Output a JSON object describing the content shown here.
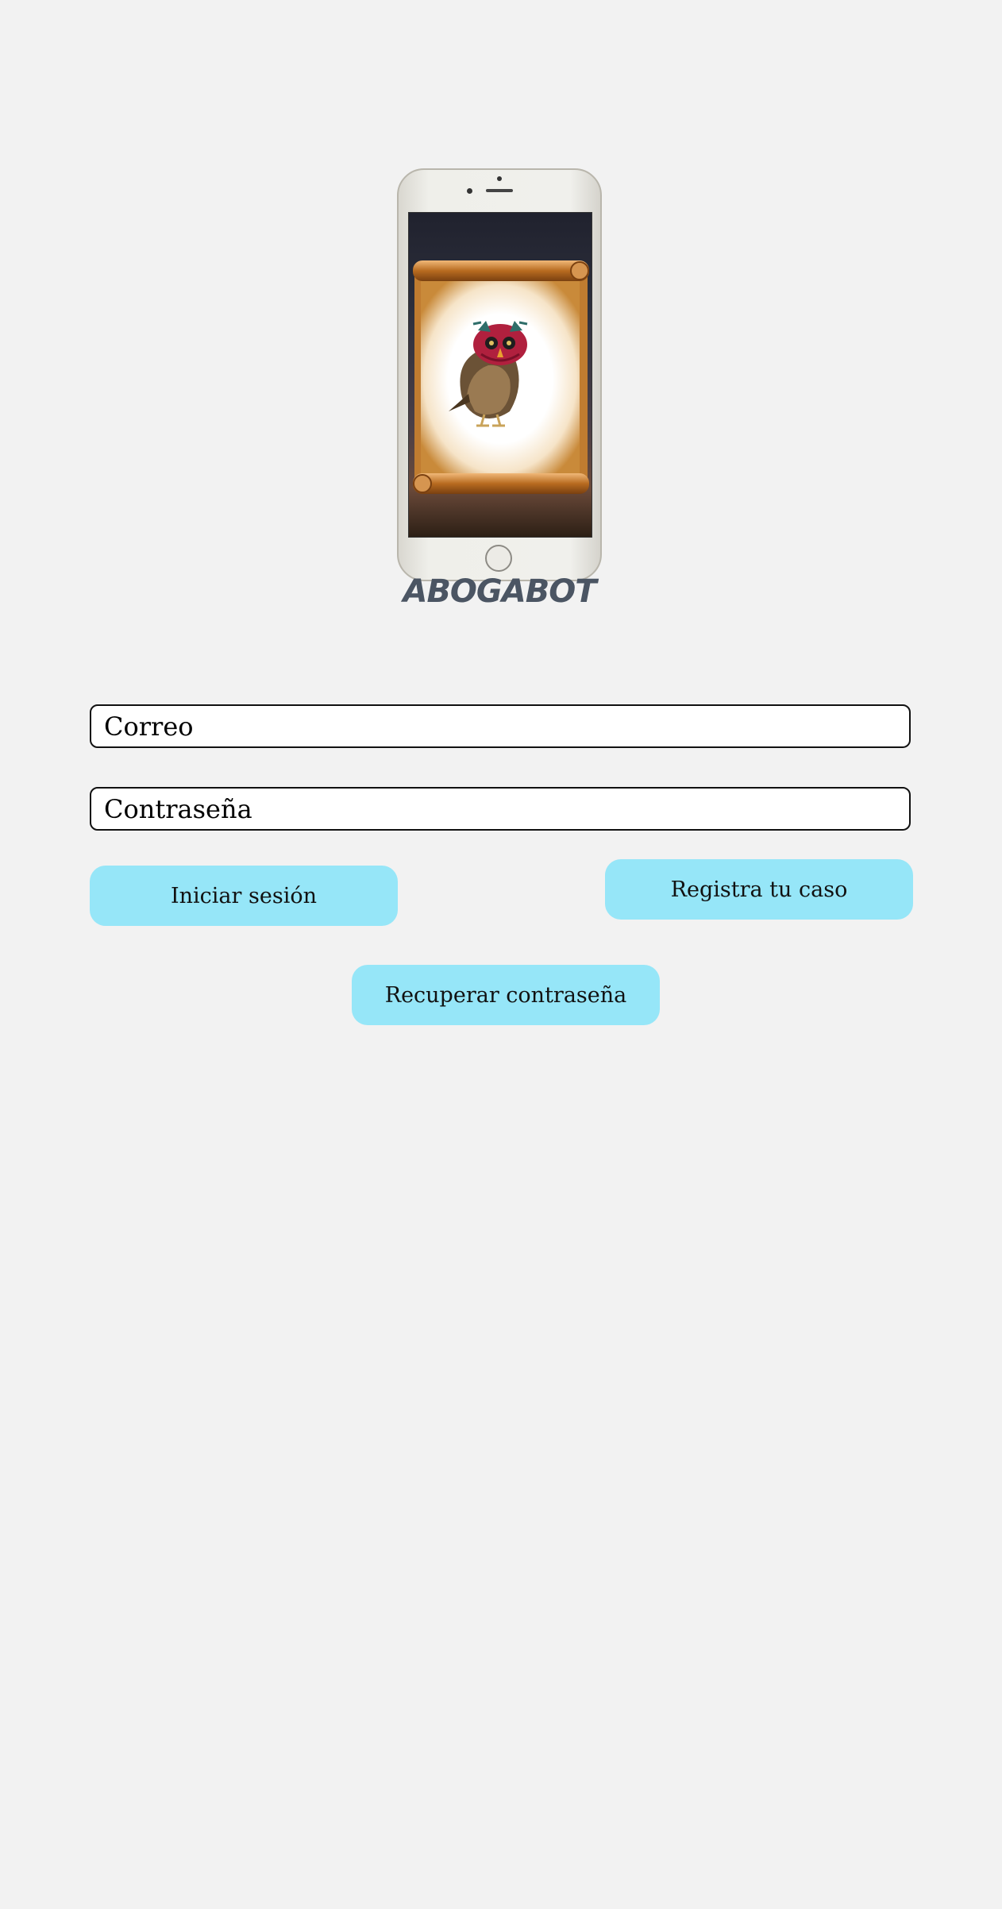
{
  "logo": {
    "app_name": "ABOGABOT",
    "image_icon": "owl-on-scroll-phone-illustration"
  },
  "form": {
    "email_placeholder": "Correo",
    "password_placeholder": "Contraseña"
  },
  "actions": {
    "login_label": "Iniciar sesión",
    "register_label": "Registra tu caso",
    "recover_label": "Recuperar contraseña"
  },
  "colors": {
    "background": "#f2f2f2",
    "button": "#96e6f8",
    "brand_text": "#4b5563"
  }
}
